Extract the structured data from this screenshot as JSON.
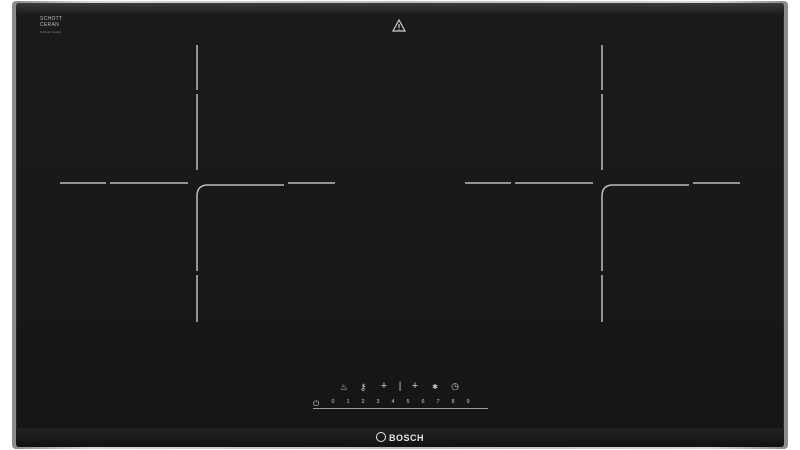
{
  "branding": {
    "glass_maker_line1": "SCHOTT",
    "glass_maker_line2": "CERAN",
    "glass_maker_small": "Schott Ceran",
    "product_brand": "BOSCH"
  },
  "controls": {
    "icons": [
      "flame-icon",
      "key-lock-icon",
      "plus-icon",
      "plus-icon",
      "star-icon",
      "timer-icon"
    ],
    "power_symbol": "⏻",
    "power_levels": [
      "0",
      "1",
      "2",
      "3",
      "4",
      "5",
      "6",
      "7",
      "8",
      "9"
    ]
  },
  "colors": {
    "glass": "#151515",
    "frame": "#bdbdbd",
    "zone_lines": "#bfbfbf"
  }
}
